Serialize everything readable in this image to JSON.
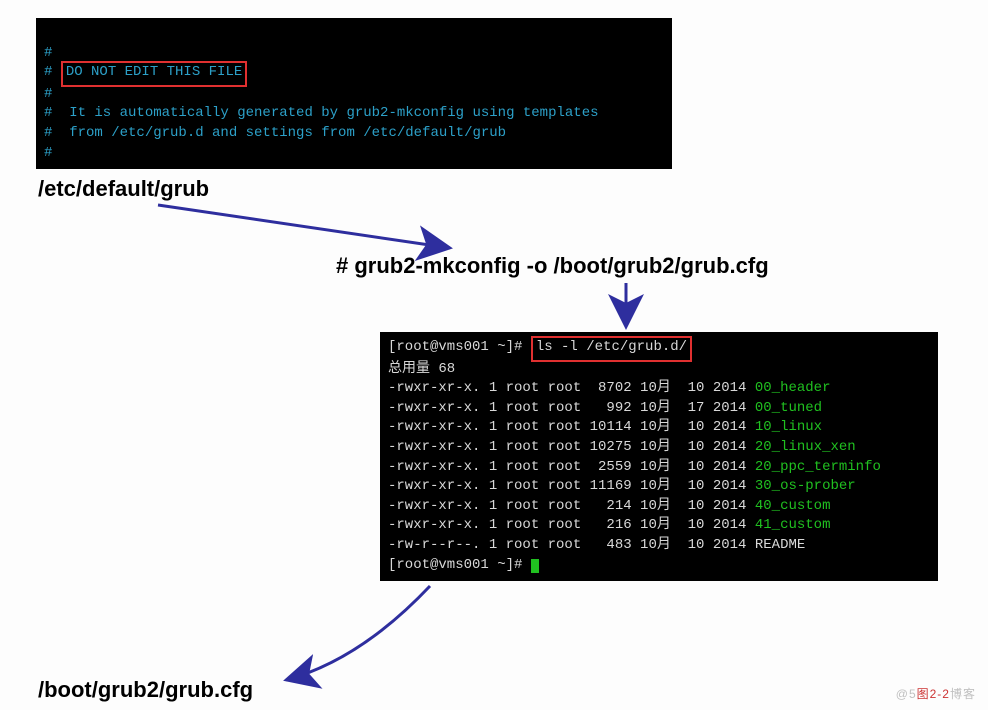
{
  "top_terminal": {
    "lines": [
      "#",
      "# ",
      "#",
      "#  It is automatically generated by grub2-mkconfig using templates",
      "#  from /etc/grub.d and settings from /etc/default/grub",
      "#"
    ],
    "highlight": "DO NOT EDIT THIS FILE"
  },
  "labels": {
    "etc_default_grub": "/etc/default/grub",
    "mkconfig_cmd": "# grub2-mkconfig -o /boot/grub2/grub.cfg",
    "boot_grub_cfg": "/boot/grub2/grub.cfg"
  },
  "bottom_terminal": {
    "prompt_user": "[root@vms001 ~]# ",
    "command": "ls -l /etc/grub.d/",
    "total_line": "总用量 68",
    "rows": [
      {
        "perm": "-rwxr-xr-x.",
        "n": "1",
        "own": "root",
        "grp": "root",
        "size": "8702",
        "mon": "10月",
        "day": "10",
        "year": "2014",
        "name": "00_header",
        "exec": true
      },
      {
        "perm": "-rwxr-xr-x.",
        "n": "1",
        "own": "root",
        "grp": "root",
        "size": "992",
        "mon": "10月",
        "day": "17",
        "year": "2014",
        "name": "00_tuned",
        "exec": true
      },
      {
        "perm": "-rwxr-xr-x.",
        "n": "1",
        "own": "root",
        "grp": "root",
        "size": "10114",
        "mon": "10月",
        "day": "10",
        "year": "2014",
        "name": "10_linux",
        "exec": true
      },
      {
        "perm": "-rwxr-xr-x.",
        "n": "1",
        "own": "root",
        "grp": "root",
        "size": "10275",
        "mon": "10月",
        "day": "10",
        "year": "2014",
        "name": "20_linux_xen",
        "exec": true
      },
      {
        "perm": "-rwxr-xr-x.",
        "n": "1",
        "own": "root",
        "grp": "root",
        "size": "2559",
        "mon": "10月",
        "day": "10",
        "year": "2014",
        "name": "20_ppc_terminfo",
        "exec": true
      },
      {
        "perm": "-rwxr-xr-x.",
        "n": "1",
        "own": "root",
        "grp": "root",
        "size": "11169",
        "mon": "10月",
        "day": "10",
        "year": "2014",
        "name": "30_os-prober",
        "exec": true
      },
      {
        "perm": "-rwxr-xr-x.",
        "n": "1",
        "own": "root",
        "grp": "root",
        "size": "214",
        "mon": "10月",
        "day": "10",
        "year": "2014",
        "name": "40_custom",
        "exec": true
      },
      {
        "perm": "-rwxr-xr-x.",
        "n": "1",
        "own": "root",
        "grp": "root",
        "size": "216",
        "mon": "10月",
        "day": "10",
        "year": "2014",
        "name": "41_custom",
        "exec": true
      },
      {
        "perm": "-rw-r--r--.",
        "n": "1",
        "own": "root",
        "grp": "root",
        "size": "483",
        "mon": "10月",
        "day": "10",
        "year": "2014",
        "name": "README",
        "exec": false
      }
    ]
  },
  "watermark": {
    "left": "@5",
    "red": "图2-2",
    "right": "博客"
  },
  "colors": {
    "arrow": "#2e2e9e",
    "redbox": "#e03030"
  }
}
